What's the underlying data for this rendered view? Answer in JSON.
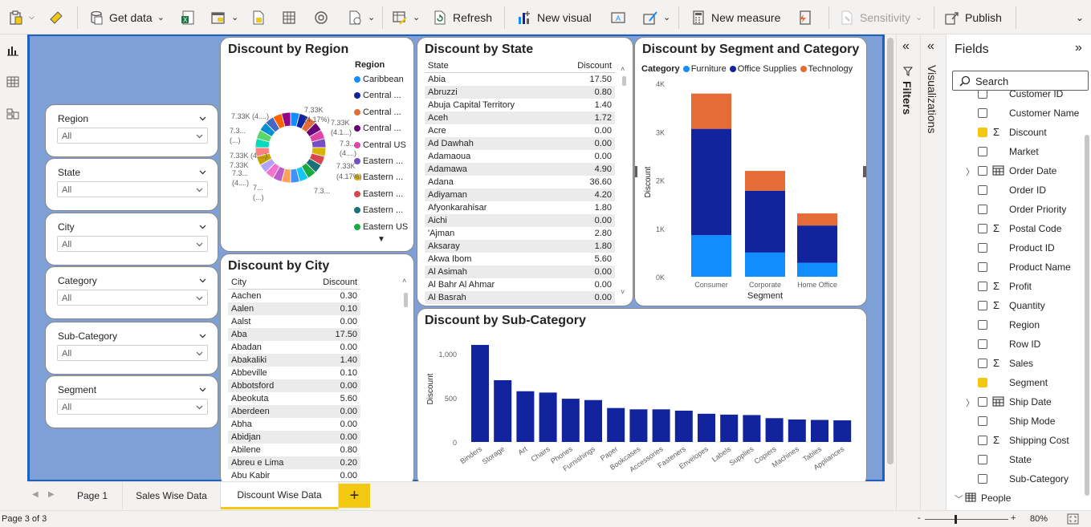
{
  "ribbon": {
    "get_data": "Get data",
    "refresh": "Refresh",
    "new_visual": "New visual",
    "new_measure": "New measure",
    "sensitivity": "Sensitivity",
    "publish": "Publish"
  },
  "slicers": [
    {
      "title": "Region",
      "value": "All"
    },
    {
      "title": "State",
      "value": "All"
    },
    {
      "title": "City",
      "value": "All"
    },
    {
      "title": "Category",
      "value": "All"
    },
    {
      "title": "Sub-Category",
      "value": "All"
    },
    {
      "title": "Segment",
      "value": "All"
    }
  ],
  "region_chart": {
    "title": "Discount by Region",
    "legend_title": "Region",
    "legend": [
      {
        "name": "Caribbean",
        "color": "#118dff"
      },
      {
        "name": "Central ...",
        "color": "#12239e"
      },
      {
        "name": "Central ...",
        "color": "#e66c37"
      },
      {
        "name": "Central ...",
        "color": "#6b007b"
      },
      {
        "name": "Central US",
        "color": "#e044a7"
      },
      {
        "name": "Eastern ...",
        "color": "#744ec2"
      },
      {
        "name": "Eastern ...",
        "color": "#d9b300"
      },
      {
        "name": "Eastern ...",
        "color": "#d64550"
      },
      {
        "name": "Eastern ...",
        "color": "#197278"
      },
      {
        "name": "Eastern US",
        "color": "#1aab40"
      }
    ],
    "labels": [
      "7.33K (4....)",
      "7.33K",
      "(4.17%)",
      "7.33K",
      "(4.1...)",
      "7.3...",
      "(...)",
      "7.3...",
      "(4....)",
      "7.33K (4....)",
      "7.33K",
      "(4.1...)",
      "7.33K",
      "(4.17%)",
      "7.3...",
      "(4....)",
      "7...",
      "(...)",
      "7.3...",
      "(4....)"
    ]
  },
  "state_table": {
    "title": "Discount by State",
    "col1": "State",
    "col2": "Discount",
    "rows": [
      [
        "Abia",
        "17.50"
      ],
      [
        "Abruzzi",
        "0.80"
      ],
      [
        "Abuja Capital Territory",
        "1.40"
      ],
      [
        "Aceh",
        "1.72"
      ],
      [
        "Acre",
        "0.00"
      ],
      [
        "Ad Dawhah",
        "0.00"
      ],
      [
        "Adamaoua",
        "0.00"
      ],
      [
        "Adamawa",
        "4.90"
      ],
      [
        "Adana",
        "36.60"
      ],
      [
        "Adiyaman",
        "4.20"
      ],
      [
        "Afyonkarahisar",
        "1.80"
      ],
      [
        "Aichi",
        "0.00"
      ],
      [
        "'Ajman",
        "2.80"
      ],
      [
        "Aksaray",
        "1.80"
      ],
      [
        "Akwa Ibom",
        "5.60"
      ],
      [
        "Al Asimah",
        "0.00"
      ],
      [
        "Al Bahr Al Ahmar",
        "0.00"
      ],
      [
        "Al Basrah",
        "0.00"
      ]
    ]
  },
  "city_table": {
    "title": "Discount by City",
    "col1": "City",
    "col2": "Discount",
    "rows": [
      [
        "Aachen",
        "0.30"
      ],
      [
        "Aalen",
        "0.10"
      ],
      [
        "Aalst",
        "0.00"
      ],
      [
        "Aba",
        "17.50"
      ],
      [
        "Abadan",
        "0.00"
      ],
      [
        "Abakaliki",
        "1.40"
      ],
      [
        "Abbeville",
        "0.10"
      ],
      [
        "Abbotsford",
        "0.00"
      ],
      [
        "Abeokuta",
        "5.60"
      ],
      [
        "Aberdeen",
        "0.00"
      ],
      [
        "Abha",
        "0.00"
      ],
      [
        "Abidjan",
        "0.00"
      ],
      [
        "Abilene",
        "0.80"
      ],
      [
        "Abreu e Lima",
        "0.20"
      ],
      [
        "Abu Kabir",
        "0.00"
      ]
    ]
  },
  "segment_chart": {
    "title": "Discount by Segment and Category",
    "legend_title": "Category",
    "xlabel": "Segment",
    "ylabel": "Discount",
    "yticks": [
      "0K",
      "1K",
      "2K",
      "3K",
      "4K"
    ]
  },
  "subcat_chart": {
    "title": "Discount by Sub-Category",
    "ylabel": "Discount",
    "yticks": [
      "0",
      "500",
      "1,000"
    ]
  },
  "chart_data": [
    {
      "type": "pie",
      "title": "Discount by Region",
      "legend_title": "Region",
      "categories": [
        "Caribbean",
        "Central ...",
        "Central ...",
        "Central ...",
        "Central US",
        "Eastern ...",
        "Eastern ...",
        "Eastern ...",
        "Eastern ...",
        "Eastern US"
      ],
      "slice_value": "7.33K",
      "slice_percent": "4.17%",
      "slice_count": 24
    },
    {
      "type": "bar",
      "stacked": true,
      "title": "Discount by Segment and Category",
      "xlabel": "Segment",
      "ylabel": "Discount",
      "categories": [
        "Consumer",
        "Corporate",
        "Home Office"
      ],
      "ylim": [
        0,
        4000
      ],
      "series": [
        {
          "name": "Furniture",
          "color": "#118dff",
          "values": [
            860,
            500,
            290
          ]
        },
        {
          "name": "Office Supplies",
          "color": "#12239e",
          "values": [
            2200,
            1280,
            770
          ]
        },
        {
          "name": "Technology",
          "color": "#e66c37",
          "values": [
            730,
            410,
            250
          ]
        }
      ]
    },
    {
      "type": "bar",
      "title": "Discount by Sub-Category",
      "ylabel": "Discount",
      "ylim": [
        0,
        1100
      ],
      "categories": [
        "Binders",
        "Storage",
        "Art",
        "Chairs",
        "Phones",
        "Furnishings",
        "Paper",
        "Bookcases",
        "Accessories",
        "Fasteners",
        "Envelopes",
        "Labels",
        "Supplies",
        "Copiers",
        "Machines",
        "Tables",
        "Appliances"
      ],
      "values": [
        1100,
        700,
        575,
        560,
        490,
        475,
        385,
        370,
        370,
        355,
        320,
        310,
        305,
        270,
        255,
        250,
        245
      ],
      "color": "#12239e"
    }
  ],
  "tabs": [
    "Page 1",
    "Sales Wise Data",
    "Discount Wise Data"
  ],
  "add_tab": "+",
  "status": {
    "page": "Page 3 of 3",
    "zoom": "80%",
    "zoom_minus": "-",
    "zoom_plus": "+"
  },
  "panes": {
    "filters": "Filters",
    "visualizations": "Visualizations",
    "fields": "Fields",
    "search": "Search"
  },
  "fields": [
    {
      "name": "Customer ID",
      "sigma": false,
      "checked": false,
      "expand": false
    },
    {
      "name": "Customer Name",
      "sigma": false,
      "checked": false,
      "expand": false
    },
    {
      "name": "Discount",
      "sigma": true,
      "checked": true,
      "expand": false
    },
    {
      "name": "Market",
      "sigma": false,
      "checked": false,
      "expand": false
    },
    {
      "name": "Order Date",
      "sigma": false,
      "checked": false,
      "expand": true,
      "cal": true
    },
    {
      "name": "Order ID",
      "sigma": false,
      "checked": false,
      "expand": false
    },
    {
      "name": "Order Priority",
      "sigma": false,
      "checked": false,
      "expand": false
    },
    {
      "name": "Postal Code",
      "sigma": true,
      "checked": false,
      "expand": false
    },
    {
      "name": "Product ID",
      "sigma": false,
      "checked": false,
      "expand": false
    },
    {
      "name": "Product Name",
      "sigma": false,
      "checked": false,
      "expand": false
    },
    {
      "name": "Profit",
      "sigma": true,
      "checked": false,
      "expand": false
    },
    {
      "name": "Quantity",
      "sigma": true,
      "checked": false,
      "expand": false
    },
    {
      "name": "Region",
      "sigma": false,
      "checked": false,
      "expand": false
    },
    {
      "name": "Row ID",
      "sigma": false,
      "checked": false,
      "expand": false
    },
    {
      "name": "Sales",
      "sigma": true,
      "checked": false,
      "expand": false
    },
    {
      "name": "Segment",
      "sigma": false,
      "checked": true,
      "expand": false
    },
    {
      "name": "Ship Date",
      "sigma": false,
      "checked": false,
      "expand": true,
      "cal": true
    },
    {
      "name": "Ship Mode",
      "sigma": false,
      "checked": false,
      "expand": false
    },
    {
      "name": "Shipping Cost",
      "sigma": true,
      "checked": false,
      "expand": false
    },
    {
      "name": "State",
      "sigma": false,
      "checked": false,
      "expand": false
    },
    {
      "name": "Sub-Category",
      "sigma": false,
      "checked": false,
      "expand": false
    }
  ],
  "people_table": "People"
}
